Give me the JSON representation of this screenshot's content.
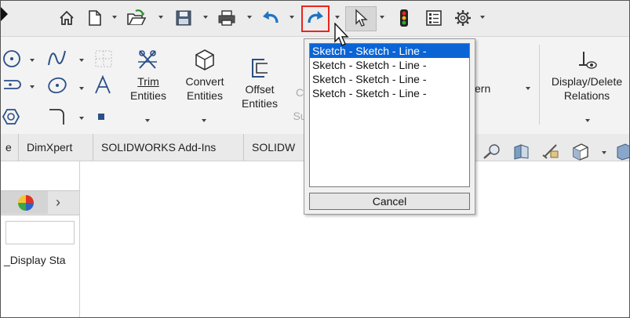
{
  "ribbon": {
    "trim_entities": "Trim\nEntities",
    "trim_l1": "Trim",
    "trim_l2": "Entities",
    "convert_l1": "Convert",
    "convert_l2": "Entities",
    "offset_l1": "Offset",
    "offset_l2": "Entities",
    "pattern_partial": "ern",
    "relations_l1": "Display/Delete",
    "relations_l2": "Relations",
    "sub_partial": "Su",
    "c_partial": "C"
  },
  "tabs": [
    "e",
    "DimXpert",
    "SOLIDWORKS Add-Ins",
    "SOLIDW"
  ],
  "left_panel": {
    "display_states": "_Display Sta"
  },
  "popup": {
    "items": [
      "Sketch - Sketch - Line -",
      "Sketch - Sketch - Line -",
      "Sketch - Sketch - Line -",
      "Sketch - Sketch - Line -"
    ],
    "selected_index": 0,
    "cancel_label": "Cancel"
  },
  "colors": {
    "highlight_box": "#e8261f",
    "selection": "#0a64d6",
    "redo_arrow": "#1f73c4"
  },
  "icons": [
    "home-icon",
    "new-document-icon",
    "open-file-icon",
    "save-icon",
    "print-icon",
    "undo-icon",
    "redo-icon",
    "select-cursor-icon",
    "rebuild-traffic-light-icon",
    "file-properties-icon",
    "options-gear-icon"
  ]
}
